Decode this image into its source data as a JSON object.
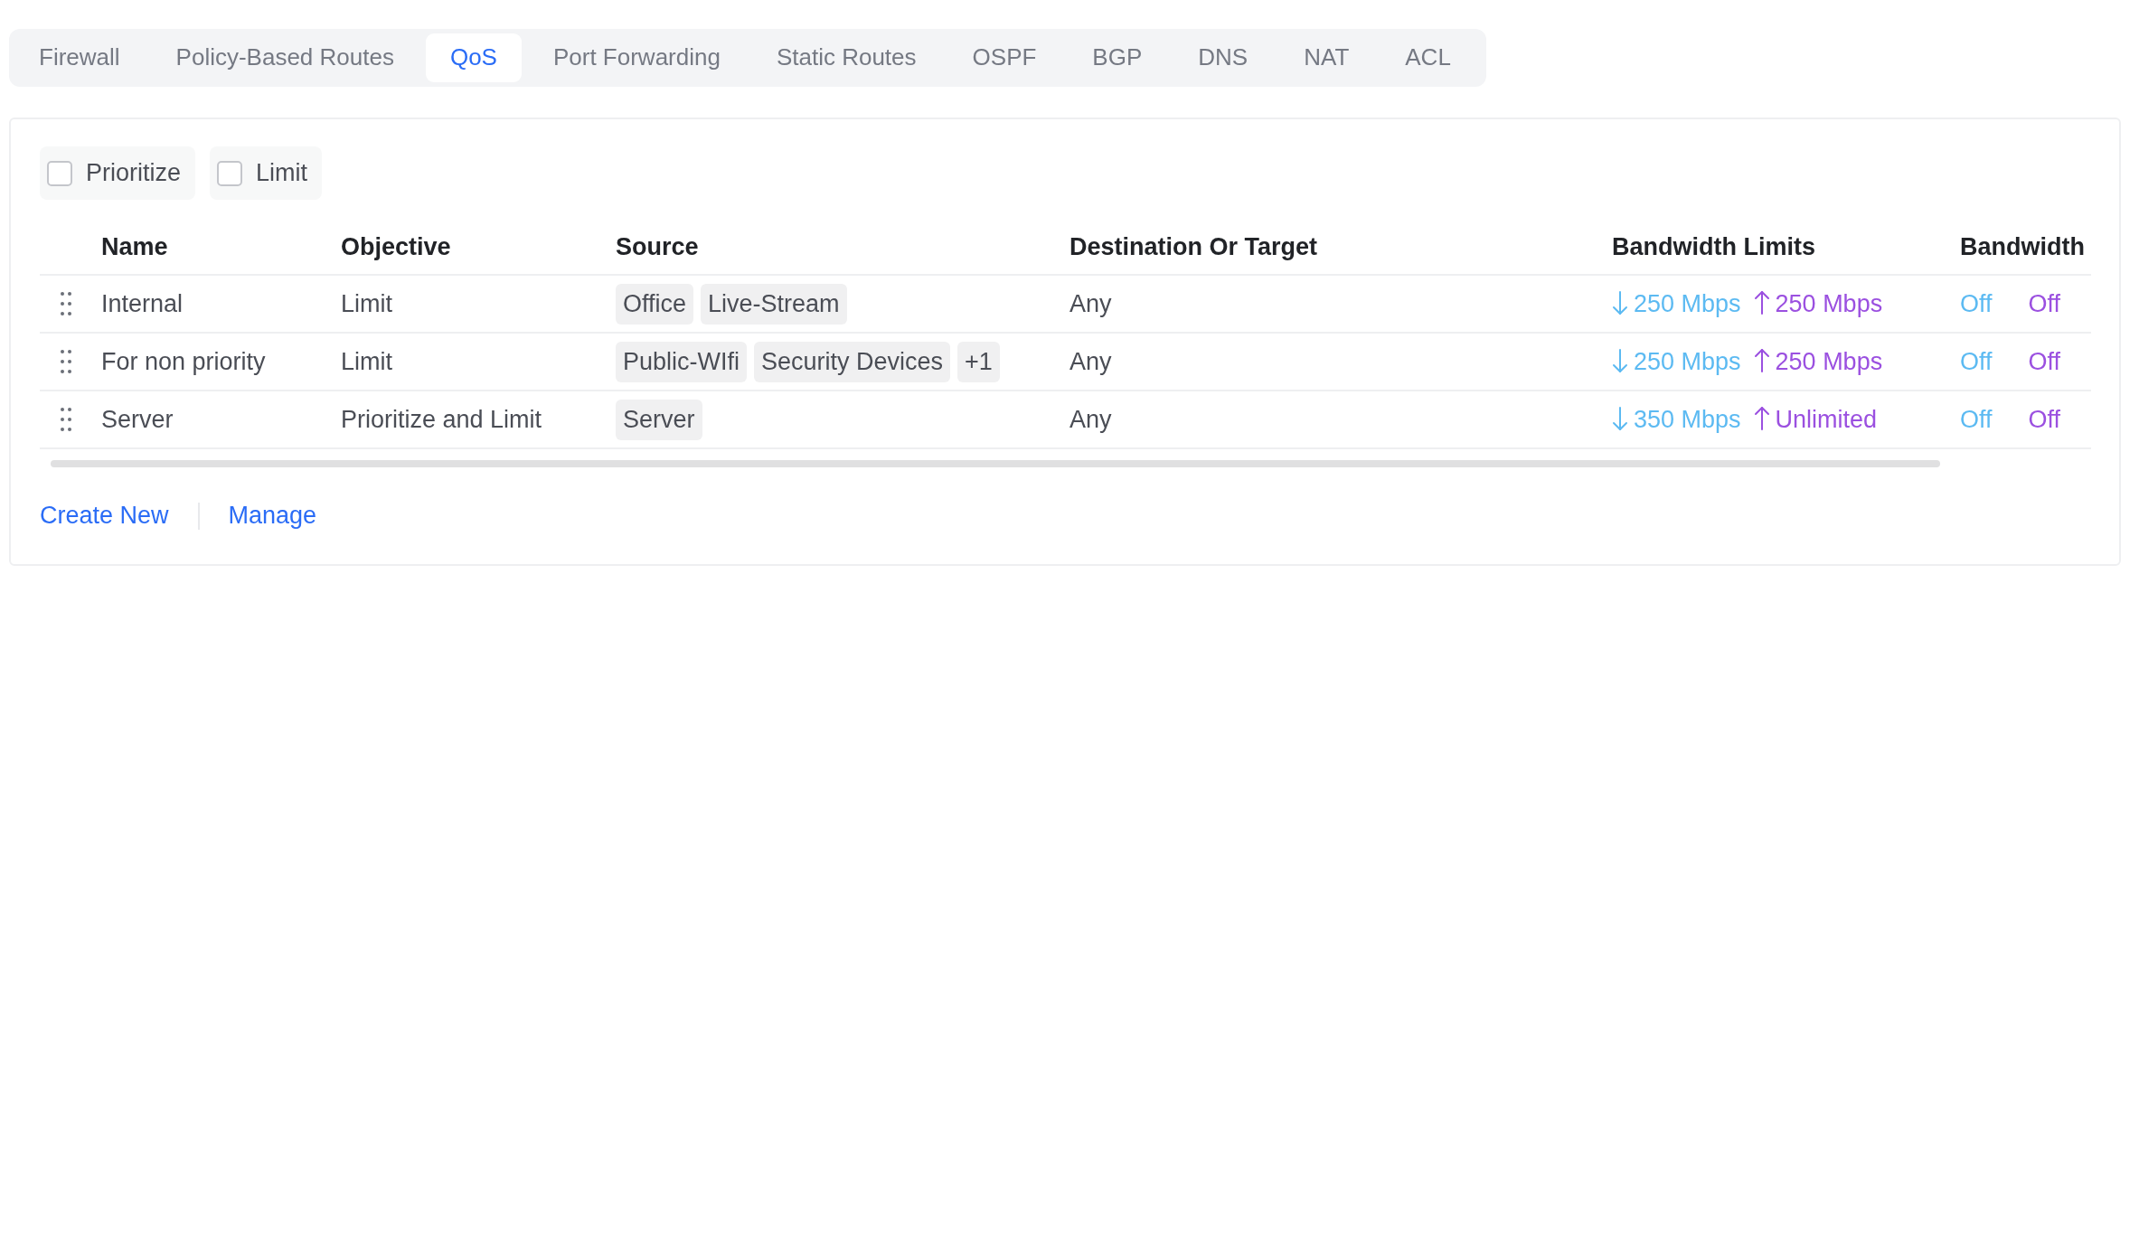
{
  "tabs": [
    {
      "label": "Firewall",
      "selected": false
    },
    {
      "label": "Policy-Based Routes",
      "selected": false
    },
    {
      "label": "QoS",
      "selected": true
    },
    {
      "label": "Port Forwarding",
      "selected": false
    },
    {
      "label": "Static Routes",
      "selected": false
    },
    {
      "label": "OSPF",
      "selected": false
    },
    {
      "label": "BGP",
      "selected": false
    },
    {
      "label": "DNS",
      "selected": false
    },
    {
      "label": "NAT",
      "selected": false
    },
    {
      "label": "ACL",
      "selected": false
    }
  ],
  "filters": [
    {
      "label": "Prioritize",
      "checked": false
    },
    {
      "label": "Limit",
      "checked": false
    }
  ],
  "table": {
    "columns": [
      "Name",
      "Objective",
      "Source",
      "Destination Or Target",
      "Bandwidth Limits",
      "Bandwidth"
    ],
    "rows": [
      {
        "name": "Internal",
        "objective": "Limit",
        "source": [
          "Office",
          "Live-Stream"
        ],
        "destination": "Any",
        "download": "250 Mbps",
        "upload": "250 Mbps",
        "bandwidth": [
          "Off",
          "Off"
        ]
      },
      {
        "name": "For non priority",
        "objective": "Limit",
        "source": [
          "Public-WIfi",
          "Security Devices",
          "+1"
        ],
        "destination": "Any",
        "download": "250 Mbps",
        "upload": "250 Mbps",
        "bandwidth": [
          "Off",
          "Off"
        ]
      },
      {
        "name": "Server",
        "objective": "Prioritize and Limit",
        "source": [
          "Server"
        ],
        "destination": "Any",
        "download": "350 Mbps",
        "upload": "Unlimited",
        "bandwidth": [
          "Off",
          "Off"
        ]
      }
    ]
  },
  "actions": [
    "Create New",
    "Manage"
  ]
}
